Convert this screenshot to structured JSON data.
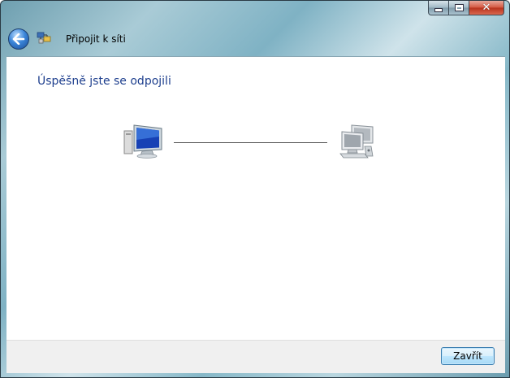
{
  "window": {
    "title": "Připojit k síti",
    "caption_buttons": {
      "minimize_icon": "minimize-icon",
      "maximize_icon": "maximize-icon",
      "close_glyph": "✕"
    }
  },
  "nav": {
    "back_icon": "back-arrow-icon",
    "app_icon": "network-connect-icon"
  },
  "content": {
    "heading": "Úspěšně jste se odpojili",
    "left_icon": "computer-icon",
    "right_icon": "network-icon"
  },
  "footer": {
    "close_label": "Zavřít"
  },
  "colors": {
    "heading": "#1e3f8e",
    "accent": "#3c7fb1"
  }
}
